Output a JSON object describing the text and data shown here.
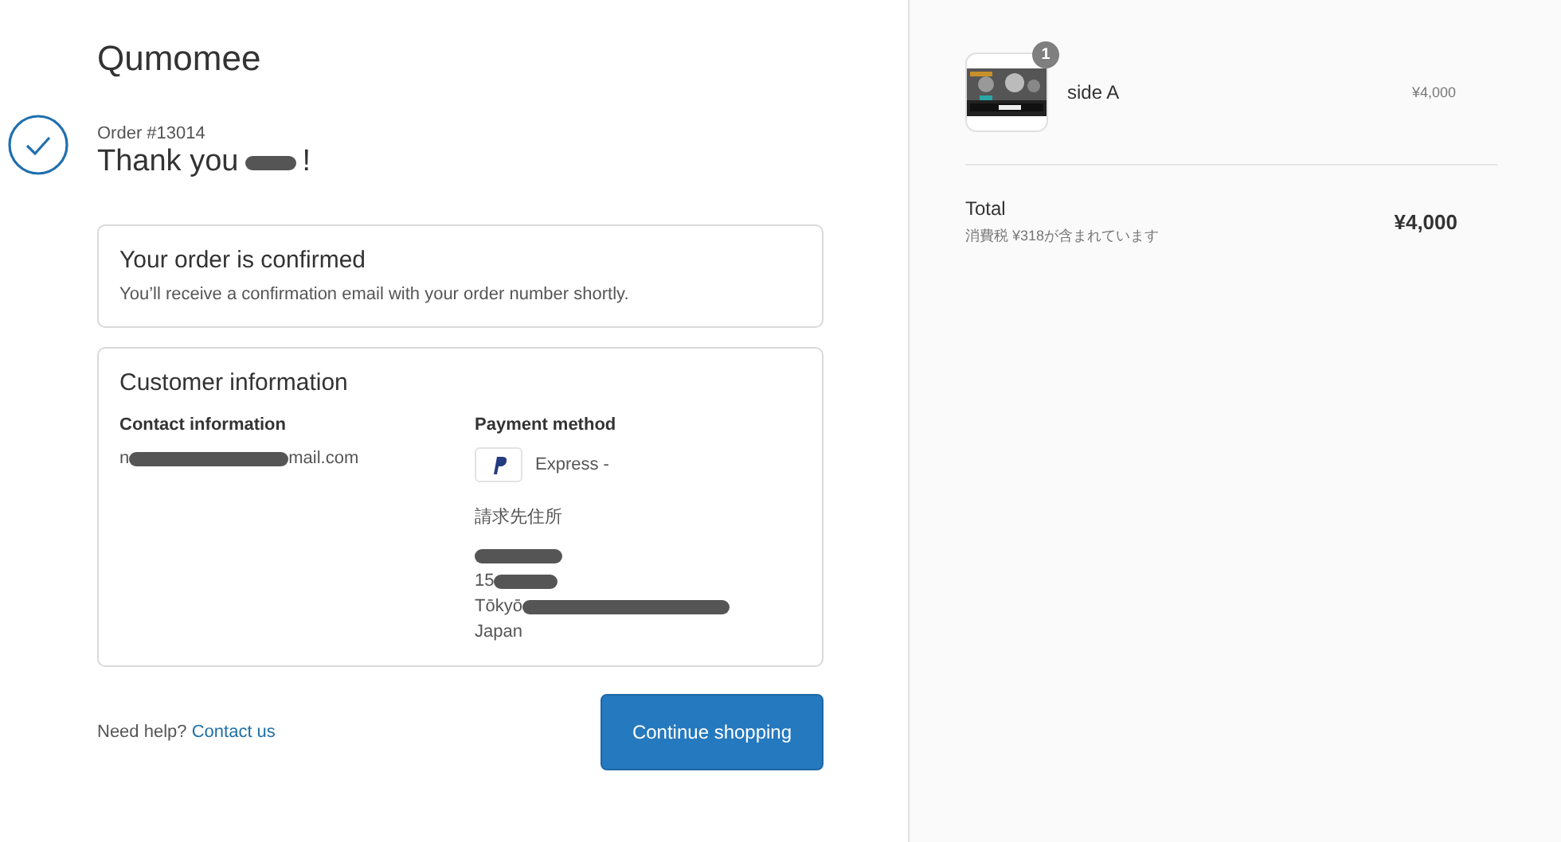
{
  "shop": {
    "name": "Qumomee"
  },
  "order": {
    "number": "Order #13014",
    "greeting": "Thank you",
    "greeting_end": "!"
  },
  "confirmation": {
    "title": "Your order is confirmed",
    "text": "You’ll receive a confirmation email with your order number shortly."
  },
  "customer": {
    "title": "Customer information",
    "contact": {
      "label": "Contact information",
      "email_visible_start": "n",
      "email_visible_end": "mail.com"
    },
    "payment": {
      "label": "Payment method",
      "method": "Express -"
    },
    "billing": {
      "label": "請求先住所",
      "lines": [
        {
          "redacted": true
        },
        {
          "visible": "15",
          "redacted": true
        },
        {
          "visible": "Tōkyō",
          "redacted": true
        },
        {
          "visible": "Japan",
          "redacted": false
        }
      ]
    }
  },
  "footer": {
    "help": "Need help?",
    "link": "Contact us",
    "button": "Continue shopping"
  },
  "summary": {
    "items": [
      {
        "quantity": "1",
        "name": "side A",
        "price": "¥4,000"
      }
    ],
    "total_label": "Total",
    "tax_note": "消費税 ¥318が含まれています",
    "total": "¥4,000"
  }
}
